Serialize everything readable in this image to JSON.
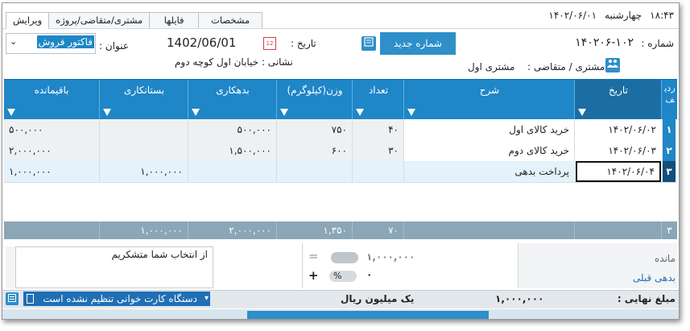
{
  "tabs": [
    "ویرایش",
    "مشتری/متقاضی/پروژه",
    "فایلها",
    "مشخصات"
  ],
  "clock": {
    "time": "۱۸:۴۳",
    "day": "چهارشنبه",
    "date": "۱۴۰۲/۰۶/۰۱"
  },
  "form": {
    "number_label": "شماره :",
    "number_value": "۱۴۰۲۰۶-۱۰۲",
    "new_number_button": "شماره جدید",
    "date_label": "تاریخ :",
    "date_value": "1402/06/01",
    "title_label": "عنوان :",
    "title_value": "فاکتور فروش",
    "customer_label": "مشتری / متقاضی :",
    "customer_value": "مشتری اول",
    "address": "نشانی : خیابان اول کوچه دوم"
  },
  "table": {
    "headers": [
      "ردیف",
      "تاریخ",
      "شرح",
      "تعداد",
      "وزن(کیلوگرم)",
      "بدهکاری",
      "بستانکاری",
      "باقیمانده"
    ],
    "rows": [
      {
        "n": "۱",
        "date": "۱۴۰۲/۰۶/۰۲",
        "desc": "خرید کالای اول",
        "qty": "۴۰",
        "weight": "۷۵۰",
        "debit": "۵۰۰,۰۰۰",
        "credit": "",
        "balance": "۵۰۰,۰۰۰"
      },
      {
        "n": "۲",
        "date": "۱۴۰۲/۰۶/۰۳",
        "desc": "خرید کالای دوم",
        "qty": "۳۰",
        "weight": "۶۰۰",
        "debit": "۱,۵۰۰,۰۰۰",
        "credit": "",
        "balance": "۲,۰۰۰,۰۰۰"
      },
      {
        "n": "۳",
        "date": "۱۴۰۲/۰۶/۰۴",
        "desc": "پرداخت بدهی",
        "qty": "",
        "weight": "",
        "debit": "",
        "credit": "۱,۰۰۰,۰۰۰",
        "balance": "۱,۰۰۰,۰۰۰"
      }
    ],
    "totals": {
      "n": "۳",
      "qty": "۷۰",
      "weight": "۱,۳۵۰",
      "debit": "۲,۰۰۰,۰۰۰",
      "credit": "۱,۰۰۰,۰۰۰"
    }
  },
  "bottom": {
    "note": "از انتخاب شما متشکریم",
    "remain_label": "مانده",
    "prev_debt_link": "بدهی قبلی",
    "remain_value": "۱,۰۰۰,۰۰۰",
    "zero_value": "۰",
    "percent": "%",
    "plus": "+",
    "equals": "="
  },
  "status": {
    "final_label": "مبلغ نهایی :",
    "final_value": "۱,۰۰۰,۰۰۰",
    "in_words": "یک میلیون  ریال",
    "card_reader": "دستگاه کارت خوانی تنظیم نشده است"
  },
  "colors": {
    "accent": "#1f86c7",
    "button": "#2e8fc9",
    "totals": "#8ba6b6"
  }
}
